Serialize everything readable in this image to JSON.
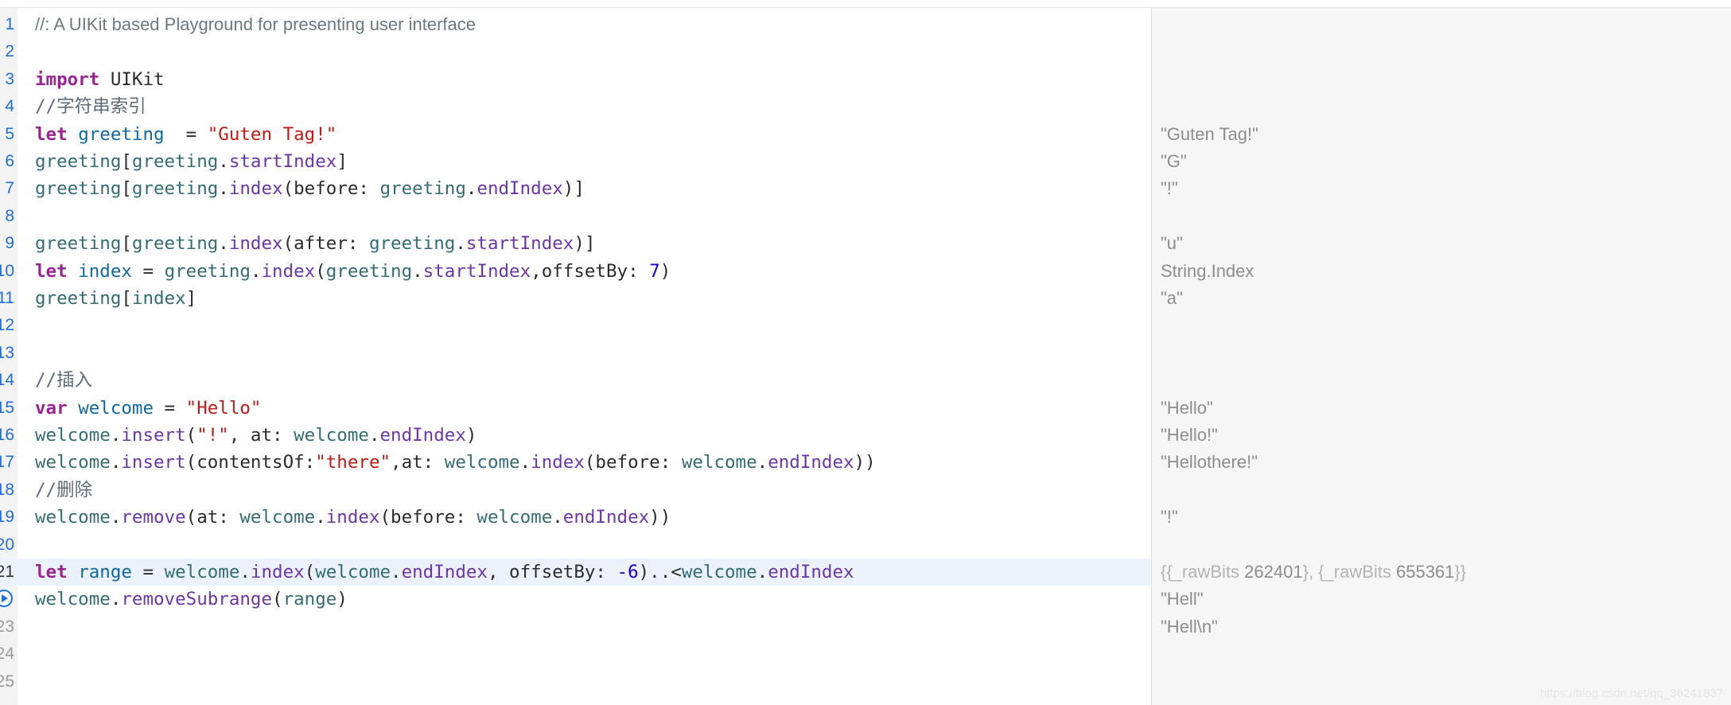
{
  "editor": {
    "lines": [
      {
        "num": "1",
        "parts": [
          {
            "t": "//: A UIKit based Playground for presenting user interface",
            "c": "comment prose"
          }
        ]
      },
      {
        "num": "2",
        "parts": []
      },
      {
        "num": "3",
        "parts": [
          {
            "t": "import",
            "c": "kw"
          },
          {
            "t": " UIKit",
            "c": ""
          }
        ]
      },
      {
        "num": "4",
        "parts": [
          {
            "t": "//字符串索引",
            "c": "comment"
          }
        ]
      },
      {
        "num": "5",
        "parts": [
          {
            "t": "let",
            "c": "kw"
          },
          {
            "t": " ",
            "c": ""
          },
          {
            "t": "greeting",
            "c": "decl"
          },
          {
            "t": "  = ",
            "c": ""
          },
          {
            "t": "\"Guten Tag!\"",
            "c": "str"
          }
        ]
      },
      {
        "num": "6",
        "parts": [
          {
            "t": "greeting",
            "c": "ident"
          },
          {
            "t": "[",
            "c": ""
          },
          {
            "t": "greeting",
            "c": "ident"
          },
          {
            "t": ".",
            "c": ""
          },
          {
            "t": "startIndex",
            "c": "prop"
          },
          {
            "t": "]",
            "c": ""
          }
        ]
      },
      {
        "num": "7",
        "parts": [
          {
            "t": "greeting",
            "c": "ident"
          },
          {
            "t": "[",
            "c": ""
          },
          {
            "t": "greeting",
            "c": "ident"
          },
          {
            "t": ".",
            "c": ""
          },
          {
            "t": "index",
            "c": "prop"
          },
          {
            "t": "(before: ",
            "c": ""
          },
          {
            "t": "greeting",
            "c": "ident"
          },
          {
            "t": ".",
            "c": ""
          },
          {
            "t": "endIndex",
            "c": "prop"
          },
          {
            "t": ")]",
            "c": ""
          }
        ]
      },
      {
        "num": "8",
        "parts": []
      },
      {
        "num": "9",
        "parts": [
          {
            "t": "greeting",
            "c": "ident"
          },
          {
            "t": "[",
            "c": ""
          },
          {
            "t": "greeting",
            "c": "ident"
          },
          {
            "t": ".",
            "c": ""
          },
          {
            "t": "index",
            "c": "prop"
          },
          {
            "t": "(after: ",
            "c": ""
          },
          {
            "t": "greeting",
            "c": "ident"
          },
          {
            "t": ".",
            "c": ""
          },
          {
            "t": "startIndex",
            "c": "prop"
          },
          {
            "t": ")]",
            "c": ""
          }
        ]
      },
      {
        "num": "10",
        "parts": [
          {
            "t": "let",
            "c": "kw"
          },
          {
            "t": " ",
            "c": ""
          },
          {
            "t": "index",
            "c": "decl"
          },
          {
            "t": " = ",
            "c": ""
          },
          {
            "t": "greeting",
            "c": "ident"
          },
          {
            "t": ".",
            "c": ""
          },
          {
            "t": "index",
            "c": "prop"
          },
          {
            "t": "(",
            "c": ""
          },
          {
            "t": "greeting",
            "c": "ident"
          },
          {
            "t": ".",
            "c": ""
          },
          {
            "t": "startIndex",
            "c": "prop"
          },
          {
            "t": ",offsetBy: ",
            "c": ""
          },
          {
            "t": "7",
            "c": "num"
          },
          {
            "t": ")",
            "c": ""
          }
        ]
      },
      {
        "num": "11",
        "parts": [
          {
            "t": "greeting",
            "c": "ident"
          },
          {
            "t": "[",
            "c": ""
          },
          {
            "t": "index",
            "c": "ident"
          },
          {
            "t": "]",
            "c": ""
          }
        ]
      },
      {
        "num": "12",
        "parts": []
      },
      {
        "num": "13",
        "parts": []
      },
      {
        "num": "14",
        "parts": [
          {
            "t": "//插入",
            "c": "comment"
          }
        ]
      },
      {
        "num": "15",
        "parts": [
          {
            "t": "var",
            "c": "kw"
          },
          {
            "t": " ",
            "c": ""
          },
          {
            "t": "welcome",
            "c": "decl"
          },
          {
            "t": " = ",
            "c": ""
          },
          {
            "t": "\"Hello\"",
            "c": "str"
          }
        ]
      },
      {
        "num": "16",
        "parts": [
          {
            "t": "welcome",
            "c": "ident"
          },
          {
            "t": ".",
            "c": ""
          },
          {
            "t": "insert",
            "c": "prop"
          },
          {
            "t": "(",
            "c": ""
          },
          {
            "t": "\"!\"",
            "c": "str"
          },
          {
            "t": ", at: ",
            "c": ""
          },
          {
            "t": "welcome",
            "c": "ident"
          },
          {
            "t": ".",
            "c": ""
          },
          {
            "t": "endIndex",
            "c": "prop"
          },
          {
            "t": ")",
            "c": ""
          }
        ]
      },
      {
        "num": "17",
        "parts": [
          {
            "t": "welcome",
            "c": "ident"
          },
          {
            "t": ".",
            "c": ""
          },
          {
            "t": "insert",
            "c": "prop"
          },
          {
            "t": "(contentsOf:",
            "c": ""
          },
          {
            "t": "\"there\"",
            "c": "str"
          },
          {
            "t": ",at: ",
            "c": ""
          },
          {
            "t": "welcome",
            "c": "ident"
          },
          {
            "t": ".",
            "c": ""
          },
          {
            "t": "index",
            "c": "prop"
          },
          {
            "t": "(before: ",
            "c": ""
          },
          {
            "t": "welcome",
            "c": "ident"
          },
          {
            "t": ".",
            "c": ""
          },
          {
            "t": "endIndex",
            "c": "prop"
          },
          {
            "t": "))",
            "c": ""
          }
        ]
      },
      {
        "num": "18",
        "parts": [
          {
            "t": "//删除",
            "c": "comment"
          }
        ]
      },
      {
        "num": "19",
        "parts": [
          {
            "t": "welcome",
            "c": "ident"
          },
          {
            "t": ".",
            "c": ""
          },
          {
            "t": "remove",
            "c": "prop"
          },
          {
            "t": "(at: ",
            "c": ""
          },
          {
            "t": "welcome",
            "c": "ident"
          },
          {
            "t": ".",
            "c": ""
          },
          {
            "t": "index",
            "c": "prop"
          },
          {
            "t": "(before: ",
            "c": ""
          },
          {
            "t": "welcome",
            "c": "ident"
          },
          {
            "t": ".",
            "c": ""
          },
          {
            "t": "endIndex",
            "c": "prop"
          },
          {
            "t": "))",
            "c": ""
          }
        ]
      },
      {
        "num": "20",
        "parts": []
      },
      {
        "num": "21",
        "parts": [
          {
            "t": "let",
            "c": "kw"
          },
          {
            "t": " ",
            "c": ""
          },
          {
            "t": "range",
            "c": "decl"
          },
          {
            "t": " = ",
            "c": ""
          },
          {
            "t": "welcome",
            "c": "ident"
          },
          {
            "t": ".",
            "c": ""
          },
          {
            "t": "index",
            "c": "prop"
          },
          {
            "t": "(",
            "c": ""
          },
          {
            "t": "welcome",
            "c": "ident"
          },
          {
            "t": ".",
            "c": ""
          },
          {
            "t": "endIndex",
            "c": "prop"
          },
          {
            "t": ", offsetBy: ",
            "c": ""
          },
          {
            "t": "-6",
            "c": "num"
          },
          {
            "t": ")..<",
            "c": ""
          },
          {
            "t": "welcome",
            "c": "ident"
          },
          {
            "t": ".",
            "c": ""
          },
          {
            "t": "endIndex",
            "c": "prop"
          }
        ]
      },
      {
        "num": "",
        "run": true,
        "parts": [
          {
            "t": "welcome",
            "c": "ident"
          },
          {
            "t": ".",
            "c": ""
          },
          {
            "t": "removeSubrange",
            "c": "prop"
          },
          {
            "t": "(",
            "c": ""
          },
          {
            "t": "range",
            "c": "ident"
          },
          {
            "t": ")",
            "c": ""
          }
        ]
      },
      {
        "num": "23",
        "parts": []
      },
      {
        "num": "24",
        "parts": []
      },
      {
        "num": "25",
        "parts": []
      }
    ]
  },
  "results": [
    {
      "line": 5,
      "parts": [
        {
          "t": "\"Guten Tag!\"",
          "c": ""
        }
      ]
    },
    {
      "line": 6,
      "parts": [
        {
          "t": "\"G\"",
          "c": ""
        }
      ]
    },
    {
      "line": 7,
      "parts": [
        {
          "t": "\"!\"",
          "c": ""
        }
      ]
    },
    {
      "line": 9,
      "parts": [
        {
          "t": "\"u\"",
          "c": ""
        }
      ]
    },
    {
      "line": 10,
      "parts": [
        {
          "t": "String.Index",
          "c": ""
        }
      ]
    },
    {
      "line": 11,
      "parts": [
        {
          "t": "\"a\"",
          "c": ""
        }
      ]
    },
    {
      "line": 15,
      "parts": [
        {
          "t": "\"Hello\"",
          "c": ""
        }
      ]
    },
    {
      "line": 16,
      "parts": [
        {
          "t": "\"Hello!\"",
          "c": ""
        }
      ]
    },
    {
      "line": 17,
      "parts": [
        {
          "t": "\"Hellothere!\"",
          "c": ""
        }
      ]
    },
    {
      "line": 19,
      "parts": [
        {
          "t": "\"!\"",
          "c": ""
        }
      ]
    },
    {
      "line": 21,
      "parts": [
        {
          "t": "{{_rawBits ",
          "c": "rk"
        },
        {
          "t": "262401",
          "c": ""
        },
        {
          "t": "}, {_rawBits ",
          "c": "rk"
        },
        {
          "t": "655361",
          "c": ""
        },
        {
          "t": "}}",
          "c": "rk"
        }
      ]
    },
    {
      "line": 22,
      "parts": [
        {
          "t": "\"Hell\"",
          "c": ""
        }
      ]
    },
    {
      "line": 23,
      "parts": [
        {
          "t": "\"Hell\\n\"",
          "c": ""
        }
      ]
    }
  ],
  "current_line": 21,
  "watermark": "https://blog.csdn.net/qq_36241837"
}
